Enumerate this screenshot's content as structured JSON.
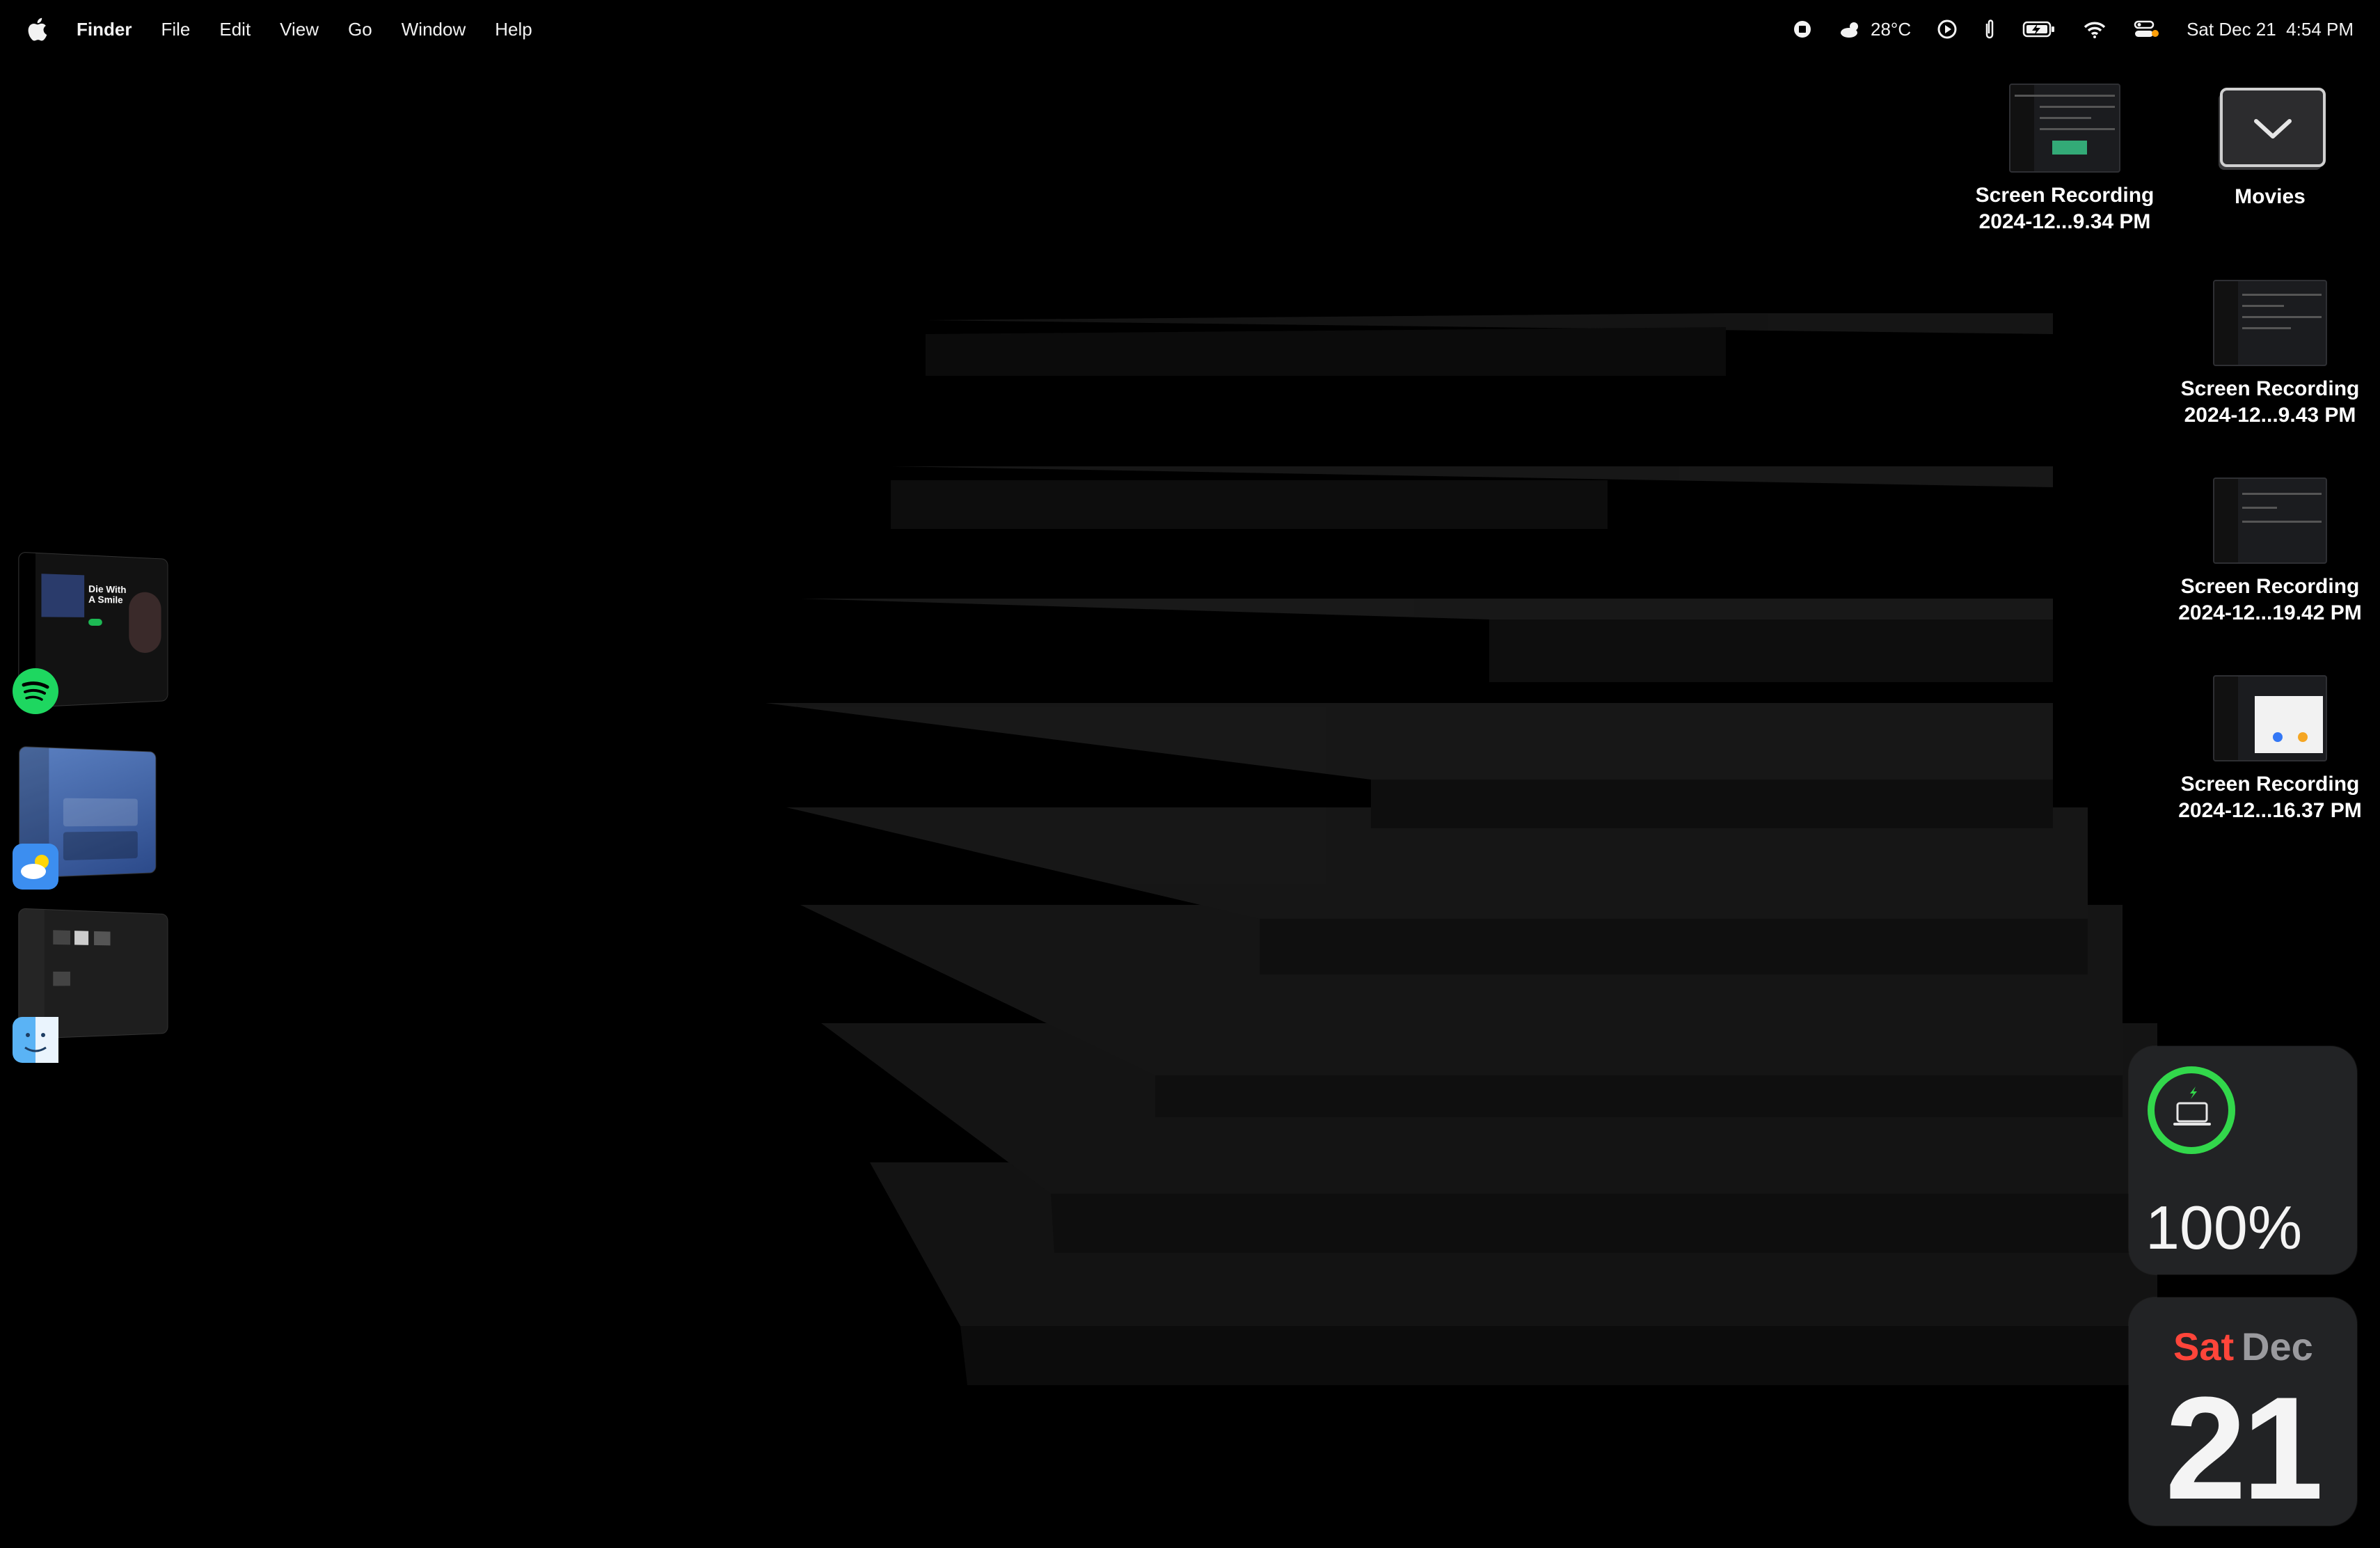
{
  "menubar": {
    "apple_icon": "apple-icon",
    "app_name": "Finder",
    "menus": [
      "File",
      "Edit",
      "View",
      "Go",
      "Window",
      "Help"
    ],
    "status": {
      "weather_icon": "partly-cloudy-icon",
      "temperature": "28°C",
      "datetime": "Sat Dec 21  4:54 PM"
    }
  },
  "desktop": {
    "items": [
      {
        "label_line1": "Screen Recording",
        "label_line2": "2024-12...9.34 PM"
      },
      {
        "label_line1": "Movies",
        "label_line2": ""
      },
      {
        "label_line1": "Screen Recording",
        "label_line2": "2024-12...9.43 PM"
      },
      {
        "label_line1": "Screen Recording",
        "label_line2": "2024-12...19.42 PM"
      },
      {
        "label_line1": "Screen Recording",
        "label_line2": "2024-12...16.37 PM"
      }
    ]
  },
  "stage_manager": {
    "apps": [
      {
        "icon": "spotify-icon",
        "preview_text": "Die With A Smile"
      },
      {
        "icon": "weather-app-icon"
      },
      {
        "icon": "finder-icon"
      }
    ]
  },
  "widgets": {
    "battery": {
      "percent": "100%",
      "level": 1.0,
      "icon": "laptop-icon",
      "ring_color": "#32d74b"
    },
    "calendar": {
      "day": "Sat",
      "month": "Dec",
      "date": "21",
      "day_color": "#ff453a"
    }
  }
}
